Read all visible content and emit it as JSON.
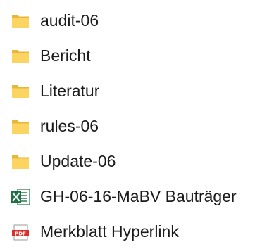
{
  "files": [
    {
      "name": "audit-06",
      "icon": "folder-icon"
    },
    {
      "name": "Bericht",
      "icon": "folder-icon"
    },
    {
      "name": "Literatur",
      "icon": "folder-icon"
    },
    {
      "name": "rules-06",
      "icon": "folder-icon"
    },
    {
      "name": "Update-06",
      "icon": "folder-icon"
    },
    {
      "name": "GH-06-16-MaBV Bauträger",
      "icon": "excel-file-icon"
    },
    {
      "name": "Merkblatt Hyperlink",
      "icon": "pdf-file-icon"
    }
  ],
  "colors": {
    "folder_back": "#E8B73A",
    "folder_front": "#FCD462",
    "excel_green": "#1E7145",
    "pdf_red": "#D8302A",
    "text": "#1B1B1B"
  }
}
